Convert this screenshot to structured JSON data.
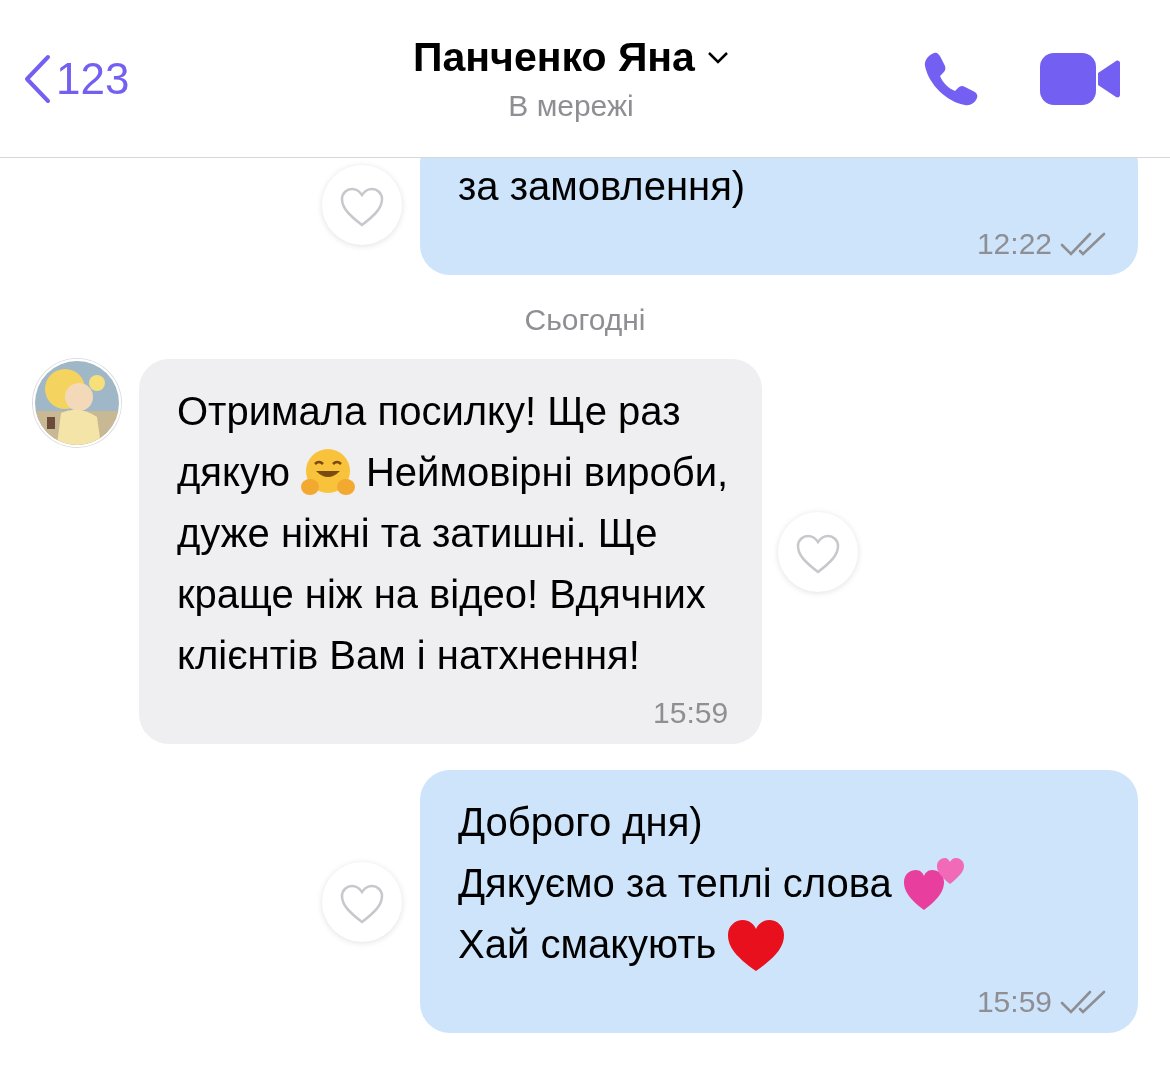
{
  "header": {
    "back_label": "123",
    "title": "Панченко Яна",
    "status": "В мережі"
  },
  "messages": [
    {
      "kind": "outgoing",
      "lines": [
        [
          {
            "kind": "text",
            "text": "за замовлення)"
          }
        ]
      ],
      "time": "12:22",
      "cut": true
    },
    {
      "kind": "date",
      "text": "Сьогодні"
    },
    {
      "kind": "incoming",
      "avatar": {
        "kind": "picture"
      },
      "lines": [
        [
          {
            "kind": "text",
            "text": "Отримала посилку! Ще раз"
          }
        ],
        [
          {
            "kind": "text",
            "text": "дякую"
          },
          {
            "kind": "hug"
          },
          {
            "kind": "text",
            "text": "Неймовірні вироби,"
          }
        ],
        [
          {
            "kind": "text",
            "text": "дуже ніжні та затишні. Ще"
          }
        ],
        [
          {
            "kind": "text",
            "text": "краще ніж на відео! Вдячних"
          }
        ],
        [
          {
            "kind": "text",
            "text": "клієнтів Вам і натхнення!"
          }
        ]
      ],
      "time": "15:59"
    },
    {
      "kind": "outgoing",
      "lines": [
        [
          {
            "kind": "text",
            "text": "Доброго дня)"
          }
        ],
        [
          {
            "kind": "text",
            "text": "Дякуємо за теплі слова"
          },
          {
            "kind": "hearts"
          }
        ],
        [
          {
            "kind": "text",
            "text": "Хай смакують"
          },
          {
            "kind": "heart"
          }
        ]
      ],
      "time": "15:59"
    }
  ]
}
